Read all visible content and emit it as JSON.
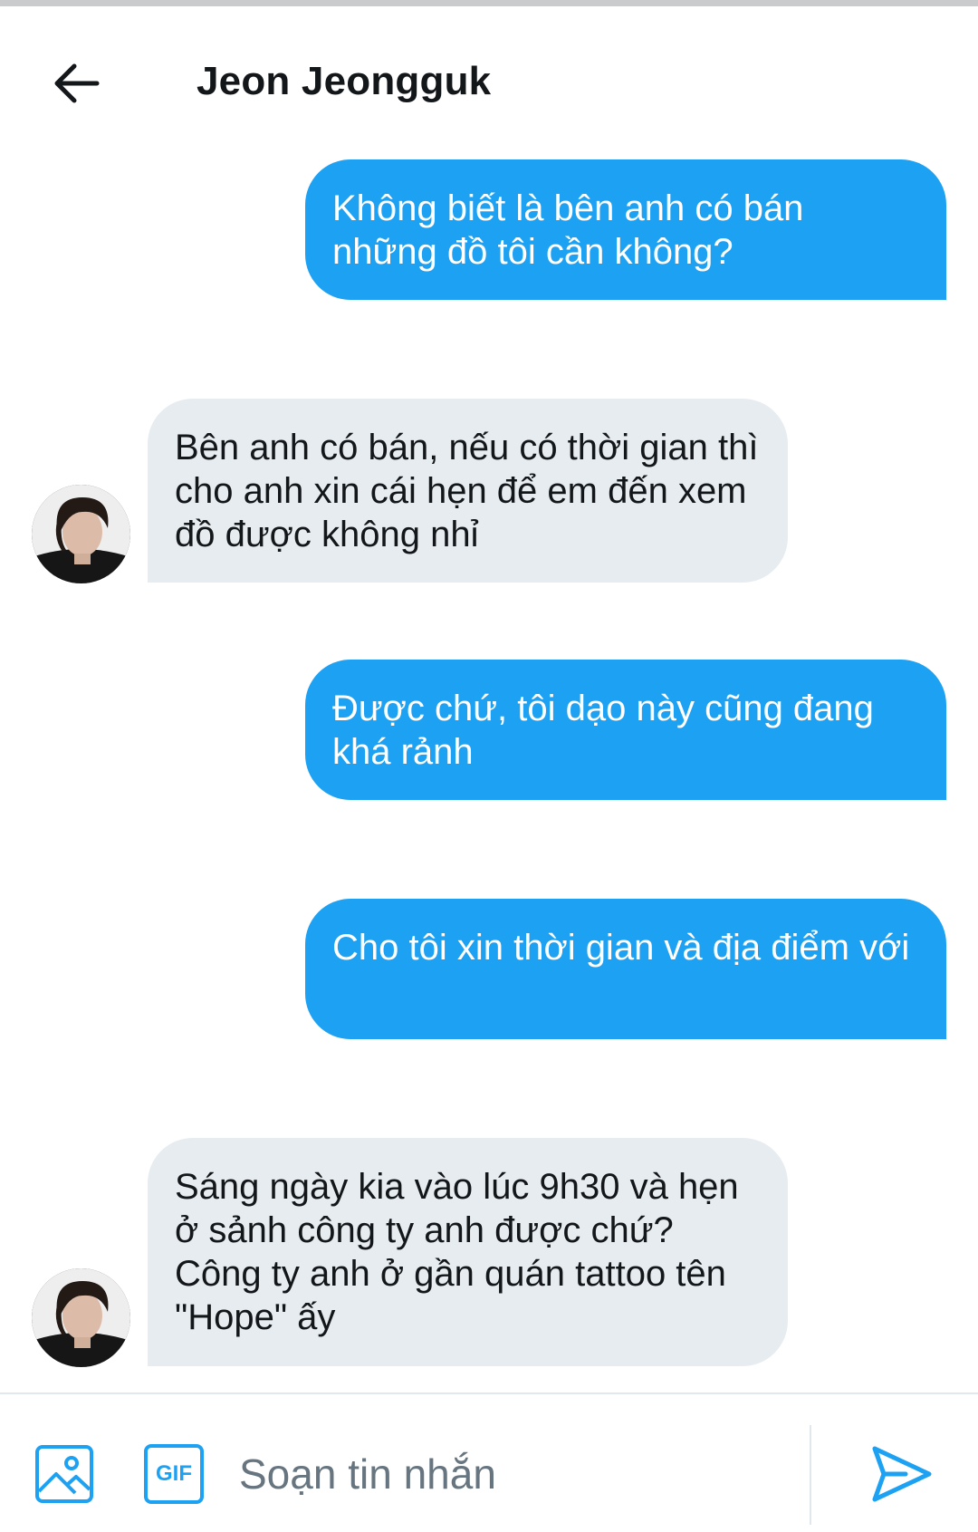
{
  "header": {
    "back_icon": "arrow-left-icon",
    "title": "Jeon Jeongguk"
  },
  "messages": [
    {
      "direction": "outgoing",
      "text": "Không biết là bên anh có bán những đồ tôi cần không?"
    },
    {
      "direction": "incoming",
      "text": "Bên anh có bán, nếu có thời gian thì cho anh xin cái hẹn để em đến xem đồ được không nhỉ"
    },
    {
      "direction": "outgoing",
      "text": "Được chứ, tôi dạo này cũng đang khá rảnh"
    },
    {
      "direction": "outgoing",
      "text": "Cho tôi xin thời gian và địa điểm với"
    },
    {
      "direction": "incoming",
      "text": "Sáng ngày kia vào lúc 9h30 và hẹn ở sảnh công ty anh được chứ? Công ty anh ở gần quán tattoo tên \"Hope\" ấy"
    }
  ],
  "composer": {
    "image_icon": "image-icon",
    "gif_label": "GIF",
    "placeholder": "Soạn tin nhắn",
    "value": "",
    "send_icon": "send-icon"
  },
  "colors": {
    "accent": "#1da1f2",
    "incoming_bubble": "#e6ecf0",
    "text": "#14171a",
    "muted": "#66757f"
  }
}
